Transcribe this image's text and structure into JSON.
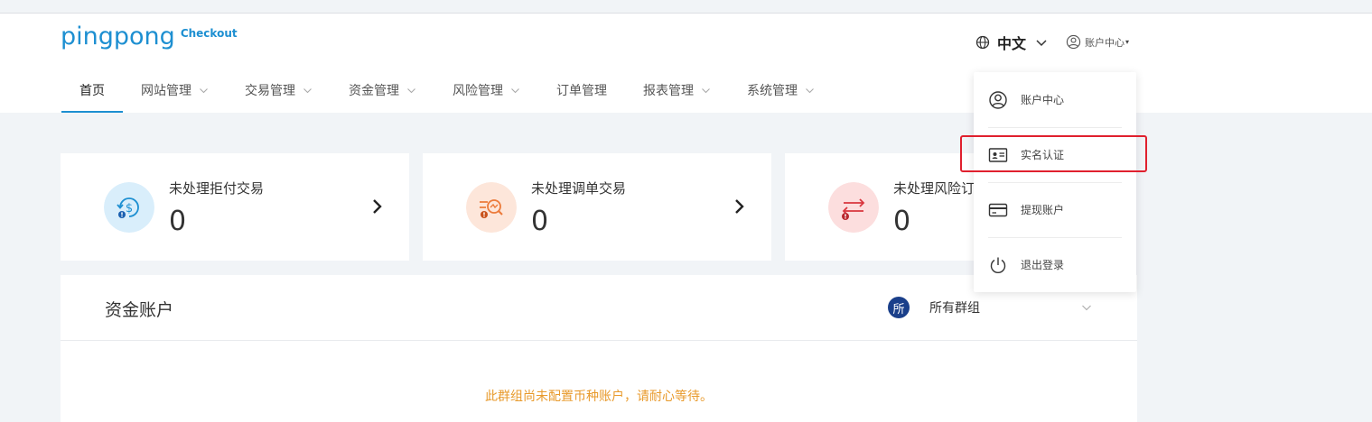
{
  "brand": {
    "name": "pingpong",
    "sub": "Checkout",
    "color": "#1d8fd1"
  },
  "header": {
    "language": {
      "icon": "globe-icon",
      "label": "中文"
    },
    "account": {
      "icon": "user-circle-icon",
      "label": "账户中心",
      "caret": "▾"
    }
  },
  "nav": {
    "items": [
      {
        "label": "首页",
        "active": true,
        "has_dropdown": false
      },
      {
        "label": "网站管理",
        "has_dropdown": true
      },
      {
        "label": "交易管理",
        "has_dropdown": true
      },
      {
        "label": "资金管理",
        "has_dropdown": true
      },
      {
        "label": "风险管理",
        "has_dropdown": true
      },
      {
        "label": "订单管理",
        "has_dropdown": false
      },
      {
        "label": "报表管理",
        "has_dropdown": true
      },
      {
        "label": "系统管理",
        "has_dropdown": true
      }
    ]
  },
  "cards": [
    {
      "title": "未处理拒付交易",
      "value": "0",
      "icon": "chargeback-dollar-icon",
      "icon_bg": "#d9eefb",
      "icon_color": "#1d8fd1"
    },
    {
      "title": "未处理调单交易",
      "value": "0",
      "icon": "retrieval-search-icon",
      "icon_bg": "#fde6da",
      "icon_color": "#ec7a3a"
    },
    {
      "title": "未处理风险订单",
      "value": "0",
      "icon": "risk-exchange-icon",
      "icon_bg": "#fcdede",
      "icon_color": "#d9363e"
    }
  ],
  "funds": {
    "title": "资金账户",
    "group_badge": "所",
    "group_select_value": "所有群组",
    "empty_message": "此群组尚未配置币种账户，请耐心等待。"
  },
  "account_menu": {
    "items": [
      {
        "label": "账户中心",
        "icon": "user-circle-icon"
      },
      {
        "label": "实名认证",
        "icon": "id-card-icon",
        "highlighted": true
      },
      {
        "label": "提现账户",
        "icon": "bank-card-icon"
      },
      {
        "label": "退出登录",
        "icon": "power-icon"
      }
    ]
  },
  "colors": {
    "accent": "#1d8fd1",
    "highlight": "#e0202e",
    "warning_text": "#e89a2c",
    "page_bg": "#f1f4f7"
  }
}
